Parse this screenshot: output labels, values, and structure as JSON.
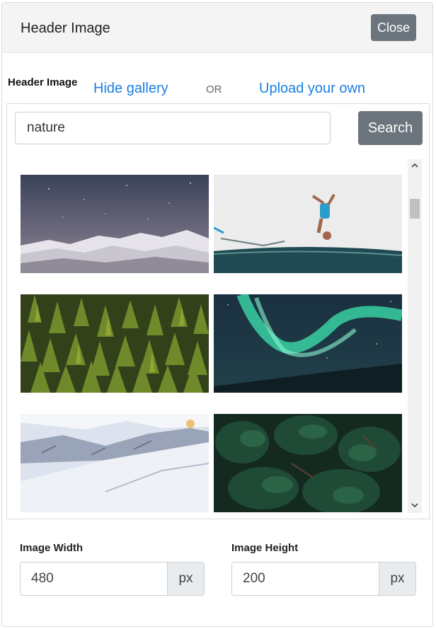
{
  "dialog": {
    "title": "Header Image",
    "close_label": "Close"
  },
  "source_row": {
    "label": "Header Image",
    "hide_gallery_label": "Hide gallery",
    "or_label": "OR",
    "upload_label": "Upload your own"
  },
  "search": {
    "value": "nature",
    "button_label": "Search"
  },
  "gallery": {
    "images": [
      {
        "subject": "starry-sky-snowy-mountains"
      },
      {
        "subject": "person-flipping-over-water"
      },
      {
        "subject": "pine-forest"
      },
      {
        "subject": "aurora-borealis"
      },
      {
        "subject": "snowy-mountain-slope"
      },
      {
        "subject": "dark-evergreen-trees"
      }
    ]
  },
  "dimensions": {
    "width_label": "Image Width",
    "width_value": "480",
    "width_unit": "px",
    "height_label": "Image Height",
    "height_value": "200",
    "height_unit": "px"
  },
  "colors": {
    "link": "#1a7fe0",
    "button": "#6c757d"
  },
  "icons": {
    "scroll_up": "chevron-up-icon",
    "scroll_down": "chevron-down-icon"
  }
}
